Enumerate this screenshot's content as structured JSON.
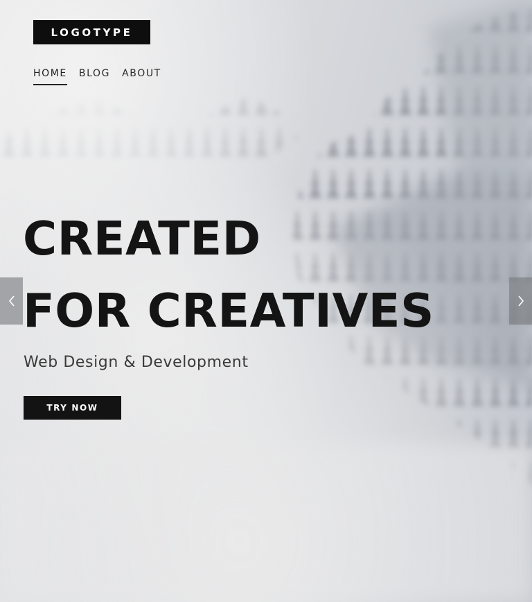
{
  "logo": {
    "text": "LOGOTYPE"
  },
  "nav": {
    "items": [
      {
        "label": "HOME",
        "active": true
      },
      {
        "label": "BLOG",
        "active": false
      },
      {
        "label": "ABOUT",
        "active": false
      }
    ]
  },
  "hero": {
    "headline_line1": "CREATED",
    "headline_line2": "FOR CREATIVES",
    "subtitle": "Web Design & Development",
    "cta_label": "TRY NOW",
    "background": "misty-forest-photo"
  },
  "slider": {
    "prev_icon": "chevron-left-icon",
    "next_icon": "chevron-right-icon"
  },
  "colors": {
    "dark": "#131313",
    "text": "#2b2b2b",
    "arrow_bg": "#797b7f",
    "mist": "#e6e6e7"
  }
}
